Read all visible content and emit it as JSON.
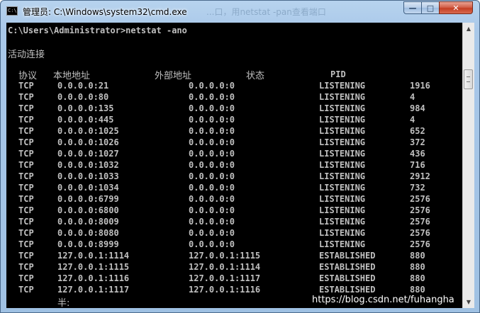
{
  "window": {
    "icon_text": "C:\\",
    "title": "管理员: C:\\Windows\\system32\\cmd.exe",
    "title_ghost": "...口，用netstat -pan查看端口",
    "minimize_glyph": "—",
    "maximize_glyph": "□",
    "close_glyph": "✕"
  },
  "console": {
    "prompt_line": "C:\\Users\\Administrator>netstat -ano",
    "section_title": "活动连接",
    "headers": {
      "proto": "协议",
      "local": "本地地址",
      "foreign": "外部地址",
      "state": "状态",
      "pid": "PID"
    },
    "rows": [
      {
        "proto": "TCP",
        "local": "0.0.0.0:21",
        "foreign": "0.0.0.0:0",
        "state": "LISTENING",
        "pid": "1916"
      },
      {
        "proto": "TCP",
        "local": "0.0.0.0:80",
        "foreign": "0.0.0.0:0",
        "state": "LISTENING",
        "pid": "4"
      },
      {
        "proto": "TCP",
        "local": "0.0.0.0:135",
        "foreign": "0.0.0.0:0",
        "state": "LISTENING",
        "pid": "984"
      },
      {
        "proto": "TCP",
        "local": "0.0.0.0:445",
        "foreign": "0.0.0.0:0",
        "state": "LISTENING",
        "pid": "4"
      },
      {
        "proto": "TCP",
        "local": "0.0.0.0:1025",
        "foreign": "0.0.0.0:0",
        "state": "LISTENING",
        "pid": "652"
      },
      {
        "proto": "TCP",
        "local": "0.0.0.0:1026",
        "foreign": "0.0.0.0:0",
        "state": "LISTENING",
        "pid": "372"
      },
      {
        "proto": "TCP",
        "local": "0.0.0.0:1027",
        "foreign": "0.0.0.0:0",
        "state": "LISTENING",
        "pid": "436"
      },
      {
        "proto": "TCP",
        "local": "0.0.0.0:1032",
        "foreign": "0.0.0.0:0",
        "state": "LISTENING",
        "pid": "716"
      },
      {
        "proto": "TCP",
        "local": "0.0.0.0:1033",
        "foreign": "0.0.0.0:0",
        "state": "LISTENING",
        "pid": "2912"
      },
      {
        "proto": "TCP",
        "local": "0.0.0.0:1034",
        "foreign": "0.0.0.0:0",
        "state": "LISTENING",
        "pid": "732"
      },
      {
        "proto": "TCP",
        "local": "0.0.0.0:6799",
        "foreign": "0.0.0.0:0",
        "state": "LISTENING",
        "pid": "2576"
      },
      {
        "proto": "TCP",
        "local": "0.0.0.0:6800",
        "foreign": "0.0.0.0:0",
        "state": "LISTENING",
        "pid": "2576"
      },
      {
        "proto": "TCP",
        "local": "0.0.0.0:8009",
        "foreign": "0.0.0.0:0",
        "state": "LISTENING",
        "pid": "2576"
      },
      {
        "proto": "TCP",
        "local": "0.0.0.0:8080",
        "foreign": "0.0.0.0:0",
        "state": "LISTENING",
        "pid": "2576"
      },
      {
        "proto": "TCP",
        "local": "0.0.0.0:8999",
        "foreign": "0.0.0.0:0",
        "state": "LISTENING",
        "pid": "2576"
      },
      {
        "proto": "TCP",
        "local": "127.0.0.1:1114",
        "foreign": "127.0.0.1:1115",
        "state": "ESTABLISHED",
        "pid": "880"
      },
      {
        "proto": "TCP",
        "local": "127.0.0.1:1115",
        "foreign": "127.0.0.1:1114",
        "state": "ESTABLISHED",
        "pid": "880"
      },
      {
        "proto": "TCP",
        "local": "127.0.0.1:1116",
        "foreign": "127.0.0.1:1117",
        "state": "ESTABLISHED",
        "pid": "880"
      },
      {
        "proto": "TCP",
        "local": "127.0.0.1:1117",
        "foreign": "127.0.0.1:1116",
        "state": "ESTABLISHED",
        "pid": "880"
      }
    ],
    "trailing_text": "半:"
  },
  "scrollbar": {
    "up_glyph": "▲",
    "down_glyph": "▼"
  },
  "watermark": "https://blog.csdn.net/fuhangha"
}
